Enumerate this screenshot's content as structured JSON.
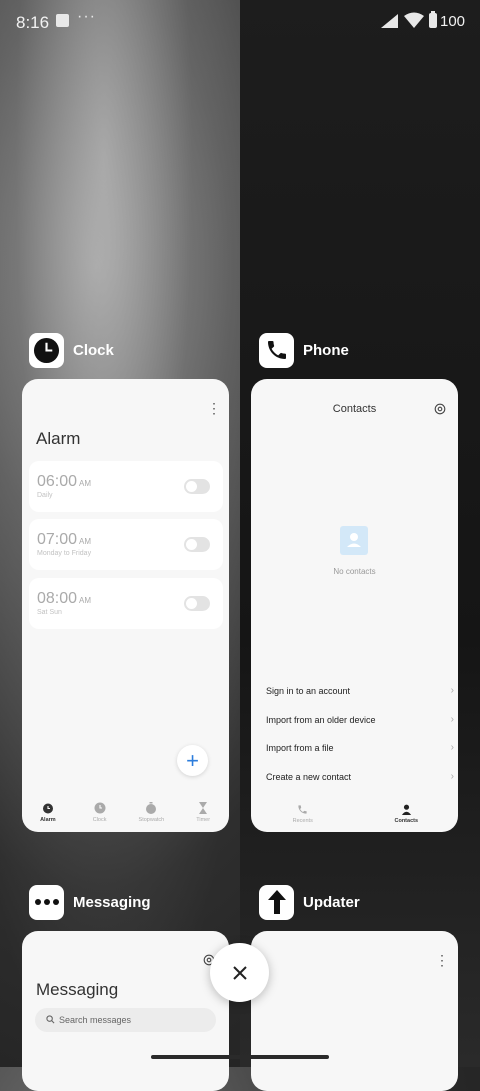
{
  "status_bar": {
    "time": "8:16",
    "overflow": "···",
    "battery_percent": "100"
  },
  "recents": [
    {
      "app_name": "Clock",
      "icon": "clock-icon",
      "screen": {
        "title": "Alarm",
        "alarms": [
          {
            "time": "06:00",
            "ampm": "AM",
            "repeat": "Daily",
            "enabled": false
          },
          {
            "time": "07:00",
            "ampm": "AM",
            "repeat": "Monday to Friday",
            "enabled": false
          },
          {
            "time": "08:00",
            "ampm": "AM",
            "repeat": "Sat Sun",
            "enabled": false
          }
        ],
        "fab": "+",
        "tabs": [
          "Alarm",
          "Clock",
          "Stopwatch",
          "Timer"
        ],
        "active_tab": "Alarm"
      }
    },
    {
      "app_name": "Phone",
      "icon": "phone-icon",
      "screen": {
        "title": "Contacts",
        "empty_text": "No contacts",
        "actions": [
          "Sign in to an account",
          "Import from an older device",
          "Import from a file",
          "Create a new contact"
        ],
        "tabs": [
          "Recents",
          "Contacts"
        ],
        "active_tab": "Contacts"
      }
    },
    {
      "app_name": "Messaging",
      "icon": "more-dots-icon",
      "screen": {
        "title": "Messaging",
        "search_placeholder": "Search messages"
      }
    },
    {
      "app_name": "Updater",
      "icon": "arrow-up-icon",
      "screen": {}
    }
  ],
  "colors": {
    "accent": "#2c7ddc",
    "card_bg": "#f7f7f7"
  }
}
